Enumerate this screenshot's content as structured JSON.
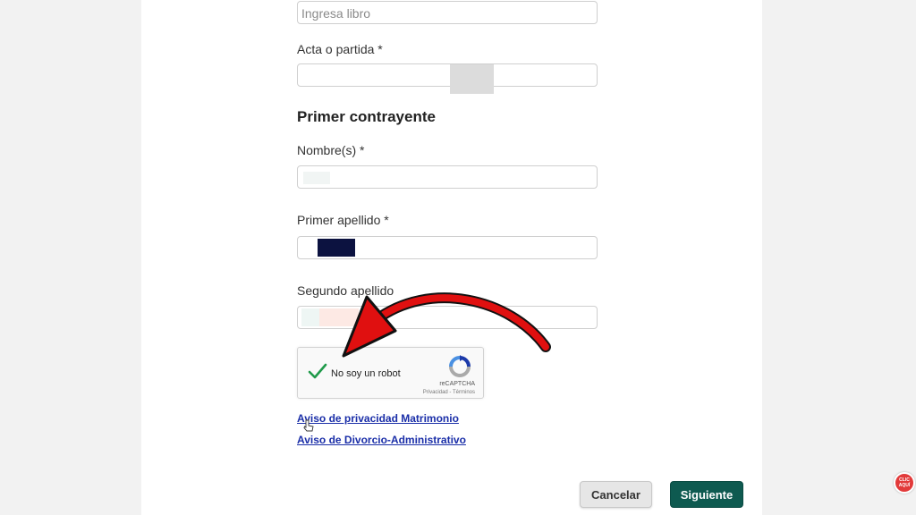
{
  "form": {
    "libro_placeholder": "Ingresa libro",
    "acta_label": "Acta o partida *",
    "section_title": "Primer contrayente",
    "nombre_label": "Nombre(s) *",
    "primer_apellido_label": "Primer apellido *",
    "segundo_apellido_label": "Segundo apellido"
  },
  "captcha": {
    "label": "No soy un robot",
    "brand": "reCAPTCHA",
    "terms": "Privacidad - Términos",
    "checked": true
  },
  "links": {
    "privacy_matrimonio": "Aviso de privacidad Matrimonio",
    "divorcio": "Aviso de Divorcio-Administrativo"
  },
  "buttons": {
    "cancel": "Cancelar",
    "next": "Siguiente"
  },
  "badge": {
    "line1": "CLIC",
    "line2": "AQUÍ"
  },
  "colors": {
    "primary": "#0e5a50",
    "link": "#1a2ea8",
    "annotation_arrow": "#e01010"
  }
}
